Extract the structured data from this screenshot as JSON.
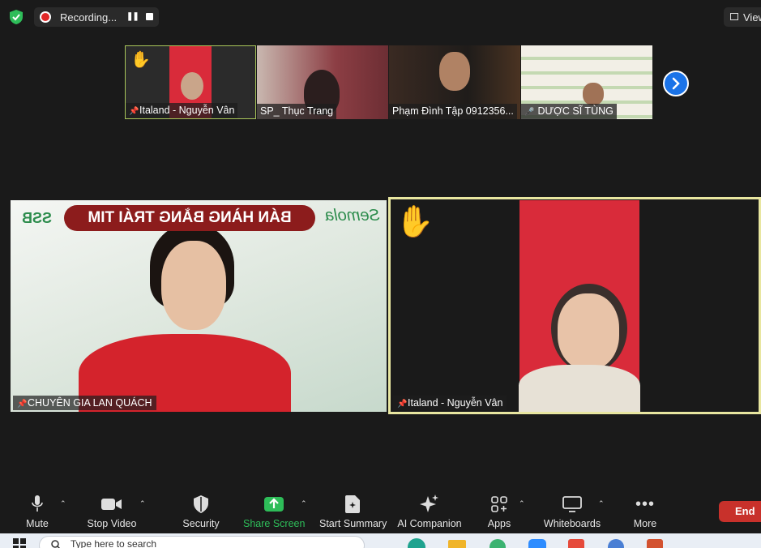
{
  "recording": {
    "label": "Recording..."
  },
  "view": {
    "label": "View"
  },
  "thumbnails": [
    {
      "name": "Italand - Nguyễn Vân",
      "pinned": true,
      "raised_hand": true
    },
    {
      "name": "SP_ Thục Trang",
      "pinned": false
    },
    {
      "name": "Phạm Đình Tập 0912356...",
      "pinned": false
    },
    {
      "name": "DƯỢC SĨ TÙNG",
      "pinned": false,
      "muted": true
    }
  ],
  "main_tiles": [
    {
      "name": "CHUYÊN GIA LAN QUÁCH",
      "pinned": true,
      "banner": "BÁN HÀNG BẰNG TRÁI TIM",
      "brand_left": "SSB",
      "brand_right": "Semola"
    },
    {
      "name": "Italand - Nguyễn Vân",
      "pinned": true,
      "raised_hand": true,
      "active_speaker": true
    }
  ],
  "toolbar": {
    "mute": "Mute",
    "stop_video": "Stop Video",
    "security": "Security",
    "share_screen": "Share Screen",
    "start_summary": "Start Summary",
    "ai_companion": "AI Companion",
    "apps": "Apps",
    "whiteboards": "Whiteboards",
    "more": "More",
    "end": "End"
  },
  "taskbar": {
    "search_placeholder": "Type here to search"
  },
  "colors": {
    "background": "#1a1a1a",
    "share_green": "#2ebd59",
    "end_red": "#c8312b",
    "active_border": "#e8e6a0",
    "next_blue": "#1a73e8"
  }
}
